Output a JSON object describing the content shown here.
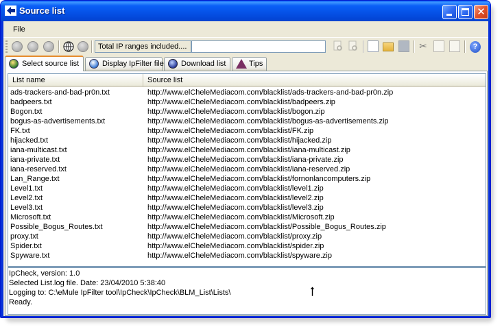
{
  "window": {
    "title": "Source list",
    "controls": {
      "minimize": "minimize",
      "maximize": "maximize",
      "close": "close"
    }
  },
  "menu": {
    "file": "File"
  },
  "toolbar": {
    "status_text": "Total IP ranges included....",
    "status_input_value": "",
    "icons": [
      "back-icon",
      "forward-icon",
      "up-icon",
      "globe-connect-icon",
      "globe-disconnect-icon",
      "find-icon",
      "find-next-icon",
      "new-icon",
      "open-folder-icon",
      "save-icon",
      "cut-icon",
      "copy-icon",
      "paste-icon",
      "help-icon"
    ]
  },
  "tabs": [
    {
      "label": "Select source list",
      "active": true
    },
    {
      "label": "Display IpFilter file",
      "active": false
    },
    {
      "label": "Download list",
      "active": false
    },
    {
      "label": "Tips",
      "active": false
    }
  ],
  "list": {
    "headers": {
      "name": "List name",
      "source": "Source list"
    },
    "rows": [
      {
        "name": "ads-trackers-and-bad-pr0n.txt",
        "source": "http://www.elCheleMediacom.com/blacklist/ads-trackers-and-bad-pr0n.zip"
      },
      {
        "name": "badpeers.txt",
        "source": "http://www.elCheleMediacom.com/blacklist/badpeers.zip"
      },
      {
        "name": "Bogon.txt",
        "source": "http://www.elCheleMediacom.com/blacklist/bogon.zip"
      },
      {
        "name": "bogus-as-advertisements.txt",
        "source": "http://www.elCheleMediacom.com/blacklist/bogus-as-advertisements.zip"
      },
      {
        "name": "FK.txt",
        "source": "http://www.elCheleMediacom.com/blacklist/FK.zip"
      },
      {
        "name": "hijacked.txt",
        "source": "http://www.elCheleMediacom.com/blacklist/hijacked.zip"
      },
      {
        "name": "iana-multicast.txt",
        "source": "http://www.elCheleMediacom.com/blacklist/iana-multicast.zip"
      },
      {
        "name": "iana-private.txt",
        "source": "http://www.elCheleMediacom.com/blacklist/iana-private.zip"
      },
      {
        "name": "iana-reserved.txt",
        "source": "http://www.elCheleMediacom.com/blacklist/iana-reserved.zip"
      },
      {
        "name": "Lan_Range.txt",
        "source": "http://www.elCheleMediacom.com/blacklist/fornonlancomputers.zip"
      },
      {
        "name": "Level1.txt",
        "source": "http://www.elCheleMediacom.com/blacklist/level1.zip"
      },
      {
        "name": "Level2.txt",
        "source": "http://www.elCheleMediacom.com/blacklist/level2.zip"
      },
      {
        "name": "Level3.txt",
        "source": "http://www.elCheleMediacom.com/blacklist/level3.zip"
      },
      {
        "name": "Microsoft.txt",
        "source": "http://www.elCheleMediacom.com/blacklist/Microsoft.zip"
      },
      {
        "name": "Possible_Bogus_Routes.txt",
        "source": "http://www.elCheleMediacom.com/blacklist/Possible_Bogus_Routes.zip"
      },
      {
        "name": "proxy.txt",
        "source": "http://www.elCheleMediacom.com/blacklist/proxy.zip"
      },
      {
        "name": "Spider.txt",
        "source": "http://www.elCheleMediacom.com/blacklist/spider.zip"
      },
      {
        "name": "Spyware.txt",
        "source": "http://www.elCheleMediacom.com/blacklist/spyware.zip"
      }
    ]
  },
  "log": {
    "lines": [
      "IpCheck, version: 1.0",
      "Selected List.log file.  Date: 23/04/2010 5:38:40",
      "Logging to: C:\\eMule IpFilter tool\\IpCheck\\IpCheck\\BLM_List\\Lists\\",
      "Ready."
    ]
  },
  "colors": {
    "title_bar": "#0a5ff7",
    "close_button": "#e0512a",
    "active_tab_accent": "#e68b2c",
    "client_bg": "#ece9d8"
  }
}
